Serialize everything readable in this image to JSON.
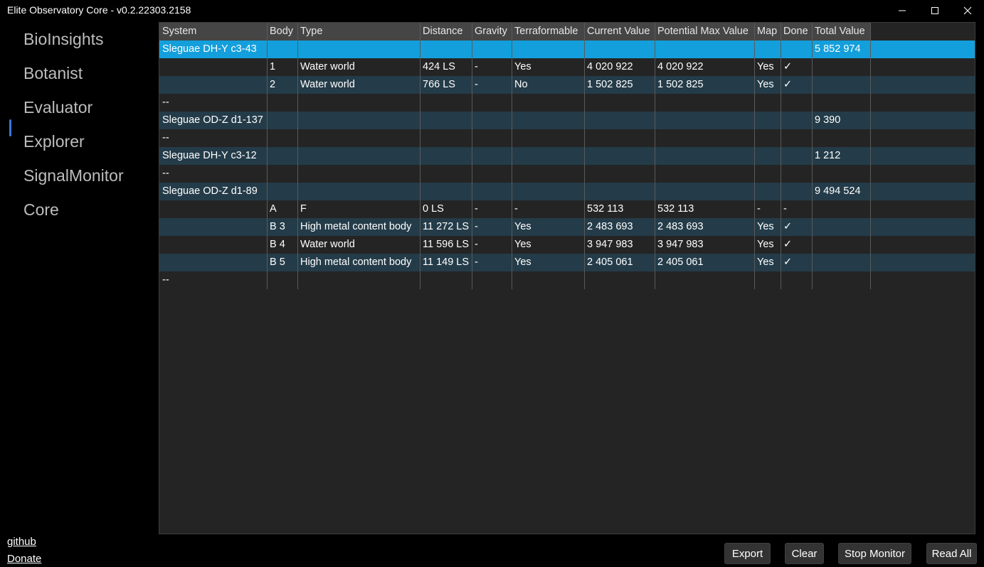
{
  "window": {
    "title": "Elite Observatory Core - v0.2.22303.2158"
  },
  "nav": {
    "items": [
      "BioInsights",
      "Botanist",
      "Evaluator",
      "Explorer",
      "SignalMonitor",
      "Core"
    ],
    "selected": "Evaluator",
    "accent_color": "#3a7bd5"
  },
  "links": {
    "github": "github",
    "donate": "Donate"
  },
  "table": {
    "columns": [
      "System",
      "Body",
      "Type",
      "Distance",
      "Gravity",
      "Terraformable",
      "Current Value",
      "Potential Max Value",
      "Map",
      "Done",
      "Total Value"
    ],
    "selected_color": "#139fdb",
    "rows": [
      [
        "Sleguae DH-Y c3-43",
        "",
        "",
        "",
        "",
        "",
        "",
        "",
        "",
        "",
        "5 852 974"
      ],
      [
        "",
        "1",
        "Water world",
        "424 LS",
        "-",
        "Yes",
        "4 020 922",
        "4 020 922",
        "Yes",
        "✓",
        ""
      ],
      [
        "",
        "2",
        "Water world",
        "766 LS",
        "-",
        "No",
        "1 502 825",
        "1 502 825",
        "Yes",
        "✓",
        ""
      ],
      [
        "--",
        "",
        "",
        "",
        "",
        "",
        "",
        "",
        "",
        "",
        ""
      ],
      [
        "Sleguae OD-Z d1-137",
        "",
        "",
        "",
        "",
        "",
        "",
        "",
        "",
        "",
        "9 390"
      ],
      [
        "--",
        "",
        "",
        "",
        "",
        "",
        "",
        "",
        "",
        "",
        ""
      ],
      [
        "Sleguae DH-Y c3-12",
        "",
        "",
        "",
        "",
        "",
        "",
        "",
        "",
        "",
        "1 212"
      ],
      [
        "--",
        "",
        "",
        "",
        "",
        "",
        "",
        "",
        "",
        "",
        ""
      ],
      [
        "Sleguae OD-Z d1-89",
        "",
        "",
        "",
        "",
        "",
        "",
        "",
        "",
        "",
        "9 494 524"
      ],
      [
        "",
        "A",
        "F",
        "0 LS",
        "-",
        "-",
        "532 113",
        "532 113",
        "-",
        "-",
        ""
      ],
      [
        "",
        "B 3",
        "High metal content body",
        "11 272 LS",
        "-",
        "Yes",
        "2 483 693",
        "2 483 693",
        "Yes",
        "✓",
        ""
      ],
      [
        "",
        "B 4",
        "Water world",
        "11 596 LS",
        "-",
        "Yes",
        "3 947 983",
        "3 947 983",
        "Yes",
        "✓",
        ""
      ],
      [
        "",
        "B 5",
        "High metal content body",
        "11 149 LS",
        "-",
        "Yes",
        "2 405 061",
        "2 405 061",
        "Yes",
        "✓",
        ""
      ],
      [
        "--",
        "",
        "",
        "",
        "",
        "",
        "",
        "",
        "",
        "",
        ""
      ]
    ]
  },
  "actions": {
    "export": "Export",
    "clear": "Clear",
    "stop_monitor": "Stop Monitor",
    "read_all": "Read All"
  }
}
